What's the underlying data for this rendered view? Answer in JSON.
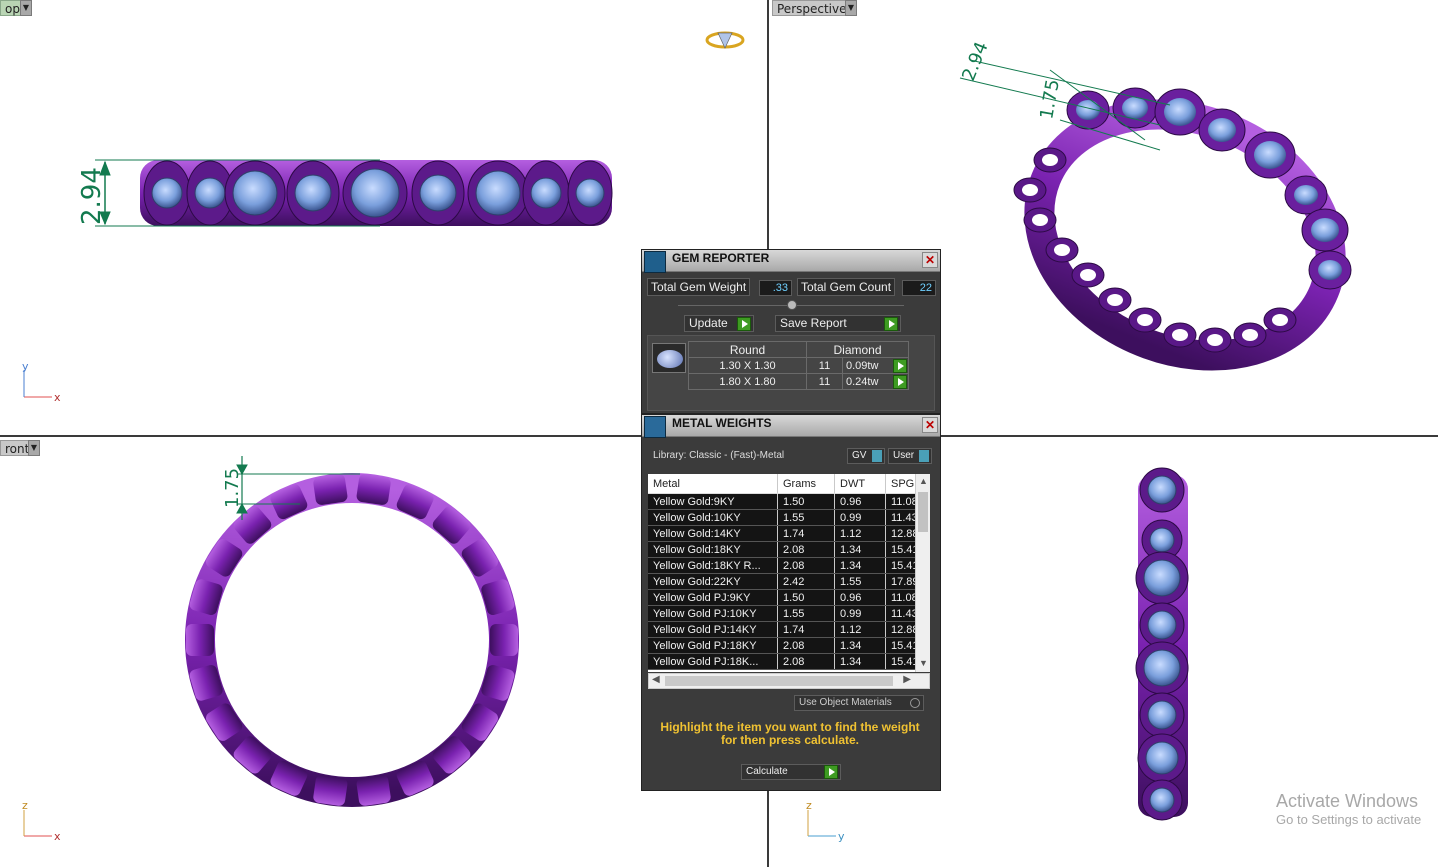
{
  "viewports": {
    "top_label": "op",
    "perspective_label": "Perspective",
    "front_label": "ront"
  },
  "dimensions": {
    "top_width": "2.94",
    "persp_width": "2.94",
    "persp_height": "1.75",
    "front_height": "1.75"
  },
  "axes": {
    "x": "x",
    "y": "y",
    "z": "z"
  },
  "gem_reporter": {
    "title": "GEM REPORTER",
    "total_weight_label": "Total Gem Weight",
    "total_weight_value": ".33",
    "total_count_label": "Total Gem Count",
    "total_count_value": "22",
    "update_label": "Update",
    "save_report_label": "Save Report",
    "shape_header": "Round",
    "material_header": "Diamond",
    "rows": [
      {
        "size": "1.30 X 1.30",
        "count": "11",
        "weight": "0.09tw"
      },
      {
        "size": "1.80 X 1.80",
        "count": "11",
        "weight": "0.24tw"
      }
    ]
  },
  "metal_weights": {
    "title": "METAL WEIGHTS",
    "library_text": "Library: Classic - (Fast)-Metal",
    "gv_label": "GV",
    "user_label": "User",
    "columns": [
      "Metal",
      "Grams",
      "DWT",
      "SPG"
    ],
    "rows": [
      [
        "Yellow Gold:9KY",
        "1.50",
        "0.96",
        "11.08"
      ],
      [
        "Yellow Gold:10KY",
        "1.55",
        "0.99",
        "11.43"
      ],
      [
        "Yellow Gold:14KY",
        "1.74",
        "1.12",
        "12.88"
      ],
      [
        "Yellow Gold:18KY",
        "2.08",
        "1.34",
        "15.41"
      ],
      [
        "Yellow Gold:18KY R...",
        "2.08",
        "1.34",
        "15.41"
      ],
      [
        "Yellow Gold:22KY",
        "2.42",
        "1.55",
        "17.89"
      ],
      [
        "Yellow Gold PJ:9KY",
        "1.50",
        "0.96",
        "11.08"
      ],
      [
        "Yellow Gold PJ:10KY",
        "1.55",
        "0.99",
        "11.43"
      ],
      [
        "Yellow Gold PJ:14KY",
        "1.74",
        "1.12",
        "12.88"
      ],
      [
        "Yellow Gold PJ:18KY",
        "2.08",
        "1.34",
        "15.41"
      ],
      [
        "Yellow Gold PJ:18K...",
        "2.08",
        "1.34",
        "15.41"
      ]
    ],
    "use_object_materials_label": "Use Object Materials",
    "hint": "Highlight the item you want to find the weight for then press calculate.",
    "calculate_label": "Calculate"
  },
  "watermark": {
    "line1": "Activate Windows",
    "line2": "Go to Settings to activate"
  },
  "colors": {
    "metal": "#7a2bb0",
    "gem": "#6f9ad8",
    "dimension": "#137a4f",
    "panel": "#3b3b3b"
  }
}
